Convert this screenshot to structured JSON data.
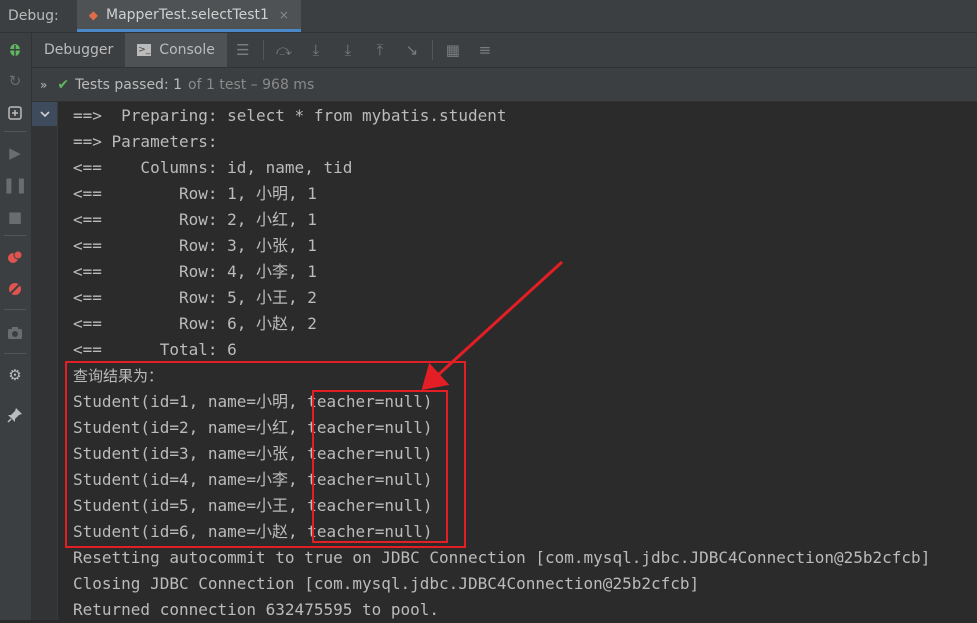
{
  "topbar": {
    "label": "Debug:",
    "tab_title": "MapperTest.selectTest1",
    "close": "×"
  },
  "toolbar": {
    "tabs": [
      {
        "label": "Debugger"
      },
      {
        "label": "Console"
      }
    ]
  },
  "status": {
    "chevron": "»",
    "passed": "Tests passed:",
    "count": "1",
    "rest": "of 1 test – 968 ms"
  },
  "console": {
    "lines": [
      "==>  Preparing: select * from mybatis.student",
      "==> Parameters: ",
      "<==    Columns: id, name, tid",
      "<==        Row: 1, 小明, 1",
      "<==        Row: 2, 小红, 1",
      "<==        Row: 3, 小张, 1",
      "<==        Row: 4, 小李, 1",
      "<==        Row: 5, 小王, 2",
      "<==        Row: 6, 小赵, 2",
      "<==      Total: 6",
      "查询结果为：",
      "Student(id=1, name=小明, teacher=null)",
      "Student(id=2, name=小红, teacher=null)",
      "Student(id=3, name=小张, teacher=null)",
      "Student(id=4, name=小李, teacher=null)",
      "Student(id=5, name=小王, teacher=null)",
      "Student(id=6, name=小赵, teacher=null)",
      "Resetting autocommit to true on JDBC Connection [com.mysql.jdbc.JDBC4Connection@25b2cfcb]",
      "Closing JDBC Connection [com.mysql.jdbc.JDBC4Connection@25b2cfcb]",
      "Returned connection 632475595 to pool."
    ]
  },
  "colors": {
    "annotation": "#e31e24",
    "pass": "#5fb85f",
    "accent": "#4a88c7"
  },
  "icons": {
    "left": [
      "debug-bug-icon",
      "rerun-icon",
      "restore-layout-icon",
      "resume-icon",
      "pause-icon",
      "stop-icon",
      "view-breakpoints-icon",
      "mute-breakpoints-icon",
      "camera-icon",
      "settings-icon",
      "pin-icon"
    ],
    "tools": [
      "list-icon",
      "step-over-icon",
      "step-into-icon",
      "force-step-into-icon",
      "step-out-icon",
      "run-to-cursor-icon",
      "evaluate-icon",
      "trace-icon"
    ]
  }
}
